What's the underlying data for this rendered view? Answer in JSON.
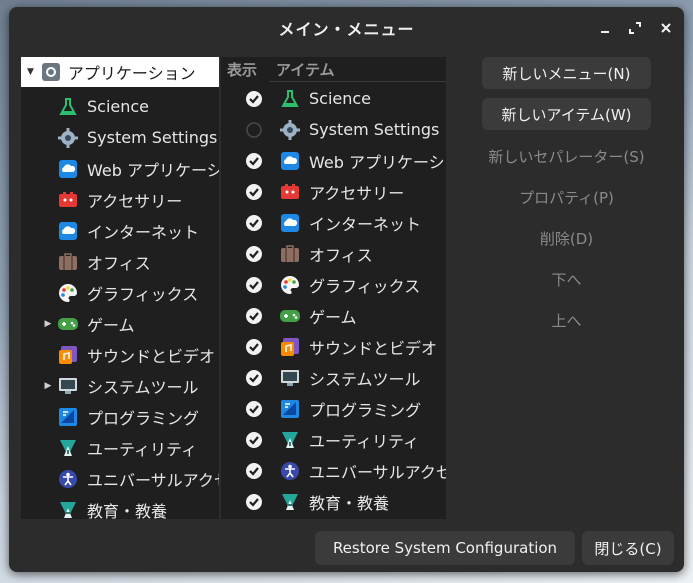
{
  "window": {
    "title": "メイン・メニュー"
  },
  "tree": {
    "root_label": "アプリケーション",
    "items": [
      {
        "label": "Science",
        "icon": "science-flask-icon",
        "expandable": false
      },
      {
        "label": "System Settings",
        "icon": "gear-icon",
        "expandable": false
      },
      {
        "label": "Web アプリケーション",
        "icon": "cloud-icon",
        "expandable": false
      },
      {
        "label": "アクセサリー",
        "icon": "accessories-icon",
        "expandable": false
      },
      {
        "label": "インターネット",
        "icon": "cloud-icon",
        "expandable": false
      },
      {
        "label": "オフィス",
        "icon": "briefcase-icon",
        "expandable": false
      },
      {
        "label": "グラフィックス",
        "icon": "palette-icon",
        "expandable": false
      },
      {
        "label": "ゲーム",
        "icon": "gamepad-icon",
        "expandable": true
      },
      {
        "label": "サウンドとビデオ",
        "icon": "media-icon",
        "expandable": false
      },
      {
        "label": "システムツール",
        "icon": "monitor-icon",
        "expandable": true
      },
      {
        "label": "プログラミング",
        "icon": "programming-icon",
        "expandable": false
      },
      {
        "label": "ユーティリティ",
        "icon": "utilities-icon",
        "expandable": false
      },
      {
        "label": "ユニバーサルアクセス",
        "icon": "accessibility-icon",
        "expandable": false
      },
      {
        "label": "教育・教養",
        "icon": "education-icon",
        "expandable": false
      }
    ]
  },
  "items_table": {
    "col_show": "表示",
    "col_item": "アイテム",
    "rows": [
      {
        "label": "Science",
        "icon": "science-flask-icon",
        "shown": true
      },
      {
        "label": "System Settings",
        "icon": "gear-icon",
        "shown": false
      },
      {
        "label": "Web アプリケーション",
        "icon": "cloud-icon",
        "shown": true
      },
      {
        "label": "アクセサリー",
        "icon": "accessories-icon",
        "shown": true
      },
      {
        "label": "インターネット",
        "icon": "cloud-icon",
        "shown": true
      },
      {
        "label": "オフィス",
        "icon": "briefcase-icon",
        "shown": true
      },
      {
        "label": "グラフィックス",
        "icon": "palette-icon",
        "shown": true
      },
      {
        "label": "ゲーム",
        "icon": "gamepad-icon",
        "shown": true
      },
      {
        "label": "サウンドとビデオ",
        "icon": "media-icon",
        "shown": true
      },
      {
        "label": "システムツール",
        "icon": "monitor-icon",
        "shown": true
      },
      {
        "label": "プログラミング",
        "icon": "programming-icon",
        "shown": true
      },
      {
        "label": "ユーティリティ",
        "icon": "utilities-icon",
        "shown": true
      },
      {
        "label": "ユニバーサルアクセス",
        "icon": "accessibility-icon",
        "shown": true
      },
      {
        "label": "教育・教養",
        "icon": "education-icon",
        "shown": true
      }
    ]
  },
  "actions": {
    "new_menu": "新しいメニュー(N)",
    "new_item": "新しいアイテム(W)",
    "new_separator": "新しいセパレーター(S)",
    "properties": "プロパティ(P)",
    "delete": "削除(D)",
    "move_down": "下へ",
    "move_up": "上へ"
  },
  "footer": {
    "restore": "Restore System Configuration",
    "close": "閉じる(C)"
  },
  "colors": {
    "window_bg": "#2c2c2c",
    "panel_bg": "#1f1f1f",
    "button_bg": "#3b3b3b",
    "selection_bg": "#ffffff"
  }
}
